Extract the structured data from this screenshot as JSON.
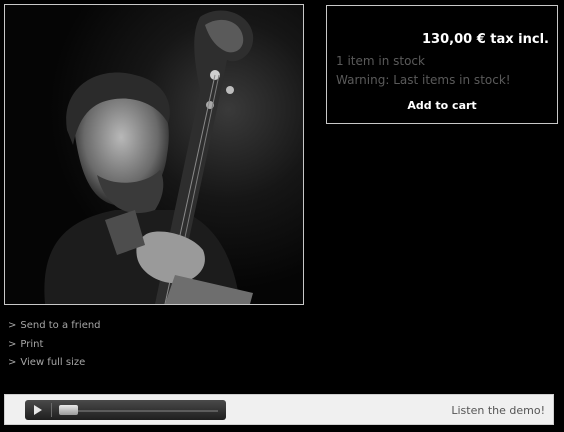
{
  "product": {
    "image_alt": "Musician playing double bass",
    "price": "130,00 € tax incl.",
    "stock": "1 item in stock",
    "warning": "Warning: Last items in stock!",
    "add_to_cart": "Add to cart"
  },
  "links": {
    "arrow": ">",
    "send_to_friend": "Send to a friend",
    "print": "Print",
    "view_full_size": "View full size"
  },
  "player": {
    "listen_label": "Listen the demo!",
    "progress": 0
  },
  "colors": {
    "background": "#000000",
    "muted_text": "#5a5a5a",
    "border": "#c8c8c8"
  }
}
